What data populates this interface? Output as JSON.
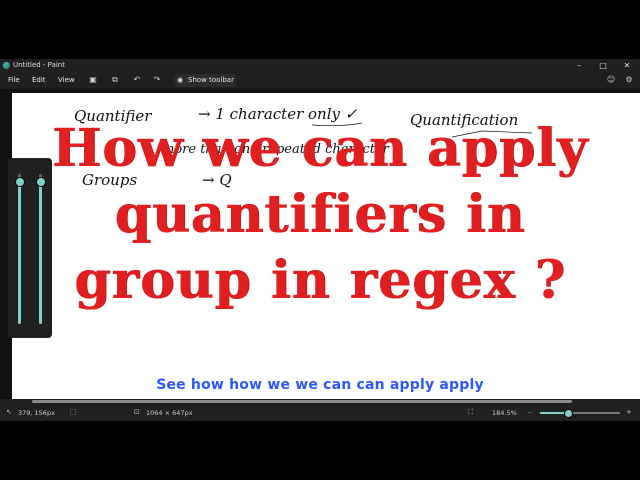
{
  "window": {
    "title": "Untitled - Paint"
  },
  "menu": {
    "file": "File",
    "edit": "Edit",
    "view": "View",
    "show_toolbar": "Show toolbar"
  },
  "icons": [
    "save-icon",
    "share-icon",
    "undo-icon",
    "redo-icon",
    "eye-icon",
    "minimize-icon",
    "maximize-icon",
    "close-icon",
    "settings-icon",
    "cursor-icon",
    "selection-icon",
    "canvas-size-icon",
    "fit-icon"
  ],
  "canvas_notes": {
    "line1_left": "Quantifier",
    "line1_mid": "→ 1 character only ✓",
    "line1_right": "Quantification",
    "line2": "more than one repeated character",
    "line3_left": "Groups",
    "line3_mid": "→ Q"
  },
  "overlay_title": {
    "line1": "How we can apply",
    "line2": "quantifiers in",
    "line3": "group in regex ?"
  },
  "caption": "See how how we we can can apply apply",
  "status": {
    "cursor_pos": "379, 156px",
    "canvas_size": "1064 × 647px",
    "zoom": "184.5%"
  },
  "sliders": {
    "left_level": 0.95,
    "right_level": 0.95,
    "zoom_level": 0.35
  },
  "colors": {
    "title_red": "#e02020",
    "caption_blue": "#2b58ff",
    "accent": "#7fd1c7"
  }
}
